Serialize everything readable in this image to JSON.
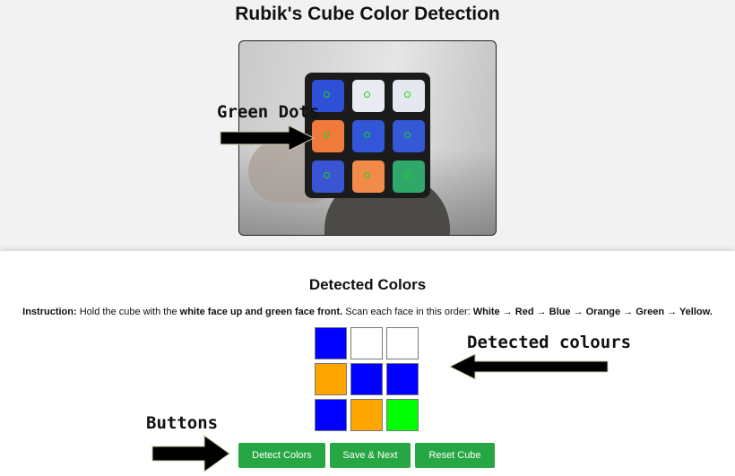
{
  "page": {
    "title": "Rubik's Cube Color Detection"
  },
  "camera": {
    "stickers": [
      [
        "#2f4fd6",
        "#e8ecf2",
        "#e5e9ef"
      ],
      [
        "#ef7a3c",
        "#3356d8",
        "#3458d6"
      ],
      [
        "#3a55d4",
        "#f28a4a",
        "#2fa86a"
      ]
    ]
  },
  "annotations": {
    "green_dots": "Green Dots",
    "detected_colours": "Detected colours",
    "buttons": "Buttons"
  },
  "detected": {
    "heading": "Detected Colors",
    "instruction": {
      "label": "Instruction:",
      "text1": "Hold the cube with the",
      "bold1": "white face up and green face front.",
      "text2": "Scan each face in this order:",
      "order": "White → Red → Blue → Orange → Green → Yellow."
    },
    "grid": [
      [
        "#0000ff",
        "#ffffff",
        "#ffffff"
      ],
      [
        "#ffa500",
        "#0000ff",
        "#0000ff"
      ],
      [
        "#0000ff",
        "#ffa500",
        "#00ff00"
      ]
    ]
  },
  "buttons": {
    "detect": "Detect Colors",
    "save": "Save & Next",
    "reset": "Reset Cube"
  },
  "colors": {
    "button": "#27a744"
  }
}
